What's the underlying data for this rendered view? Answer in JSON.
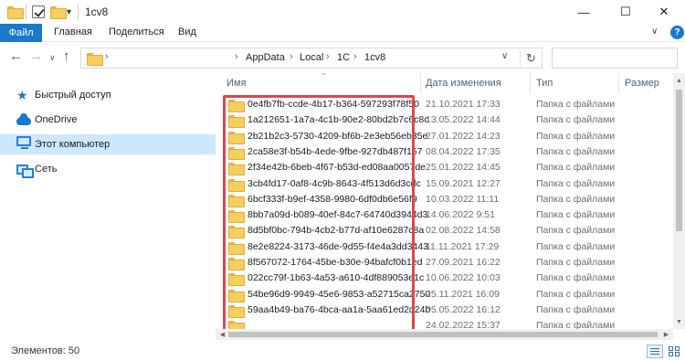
{
  "window": {
    "title": "1cv8",
    "minimize_glyph": "—",
    "maximize_glyph": "☐",
    "close_glyph": "✕",
    "dropdown_glyph": "▾"
  },
  "ribbon": {
    "file_label": "Файл",
    "tabs": [
      "Главная",
      "Поделиться",
      "Вид"
    ],
    "expand_glyph": "∨",
    "help_glyph": "?"
  },
  "nav": {
    "back_glyph": "←",
    "forward_glyph": "→",
    "history_glyph": "∨",
    "up_glyph": "↑",
    "breadcrumb": [
      "AppData",
      "Local",
      "1C",
      "1cv8"
    ],
    "breadcrumb_sep": "›",
    "refresh_glyph": "↻",
    "addr_dropdown_glyph": "∨"
  },
  "sidebar": {
    "items": [
      {
        "label": "Быстрый доступ",
        "icon": "star-icon",
        "selected": false
      },
      {
        "label": "OneDrive",
        "icon": "cloud-icon",
        "selected": false
      },
      {
        "label": "Этот компьютер",
        "icon": "computer-icon",
        "selected": true
      },
      {
        "label": "Сеть",
        "icon": "network-icon",
        "selected": false
      }
    ]
  },
  "columns": {
    "name": "Имя",
    "date": "Дата изменения",
    "type": "Тип",
    "size": "Размер",
    "sort_glyph": "^"
  },
  "files": [
    {
      "name": "0e4fb7fb-ccde-4b17-b364-597293f78f50",
      "date": "21.10.2021 17:33",
      "type": "Папка с файлами"
    },
    {
      "name": "1a212651-1a7a-4c1b-90e2-80bd2b7c6c8c",
      "date": "13.05.2022 14:44",
      "type": "Папка с файлами"
    },
    {
      "name": "2b21b2c3-5730-4209-bf6b-2e3eb56eb35e",
      "date": "27.01.2022 14:23",
      "type": "Папка с файлами"
    },
    {
      "name": "2ca58e3f-b54b-4ede-9fbe-927db487f157",
      "date": "08.04.2022 17:35",
      "type": "Папка с файлами"
    },
    {
      "name": "2f34e42b-6beb-4f67-b53d-ed08aa0057de",
      "date": "25.01.2022 14:45",
      "type": "Папка с файлами"
    },
    {
      "name": "3cb4fd17-0af8-4c9b-8643-4f513d6d3cdc",
      "date": "15.09.2021 12:27",
      "type": "Папка с файлами"
    },
    {
      "name": "6bcf333f-b9ef-4358-9980-6df0db6e56f9",
      "date": "10.03.2022 11:11",
      "type": "Папка с файлами"
    },
    {
      "name": "8bb7a09d-b089-40ef-84c7-64740d3944d3",
      "date": "14.06.2022 9:51",
      "type": "Папка с файлами"
    },
    {
      "name": "8d5bf0bc-794b-4cb2-b77d-af10e6287c8a",
      "date": "02.08.2022 14:58",
      "type": "Папка с файлами"
    },
    {
      "name": "8e2e8224-3173-46de-9d55-f4e4a3dd3443",
      "date": "11.11.2021 17:29",
      "type": "Папка с файлами"
    },
    {
      "name": "8f567072-1764-45be-b30e-94bafcf0b1ed",
      "date": "27.09.2021 16:22",
      "type": "Папка с файлами"
    },
    {
      "name": "022cc79f-1b63-4a53-a610-4df889053e1c",
      "date": "10.06.2022 10:03",
      "type": "Папка с файлами"
    },
    {
      "name": "54be96d9-9949-45e6-9853-a52715ca2750",
      "date": "25.11.2021 16:09",
      "type": "Папка с файлами"
    },
    {
      "name": "59aa4b49-ba76-4bca-aa1a-5aa61ed2d24b",
      "date": "05.05.2022 16:12",
      "type": "Папка с файлами"
    },
    {
      "name": "",
      "date": "24.02.2022 15:37",
      "type": "Папка с файлами"
    }
  ],
  "scroll": {
    "up_glyph": "▲",
    "down_glyph": "▼",
    "left_glyph": "◀",
    "right_glyph": "▶"
  },
  "status": {
    "items_label": "Элементов: 50"
  },
  "colors": {
    "accent": "#1979ca",
    "selection": "#cce8ff",
    "highlight_border": "#e0454d",
    "folder": "#f6cf5d"
  }
}
